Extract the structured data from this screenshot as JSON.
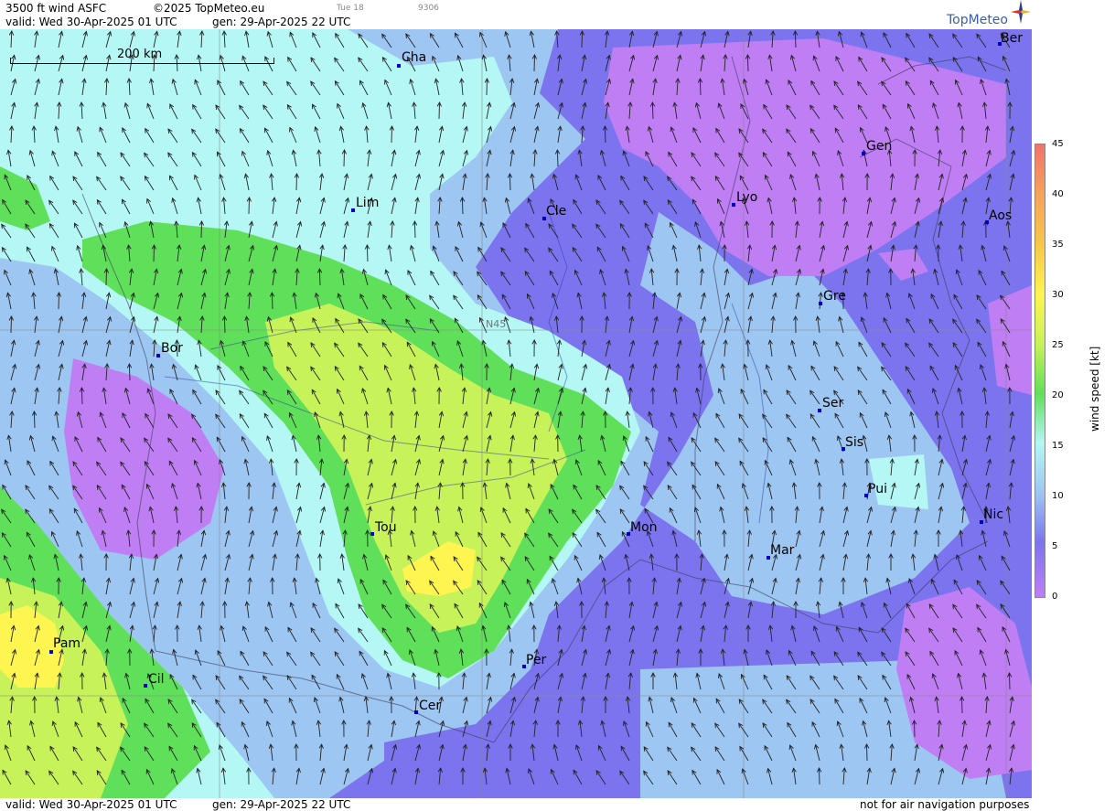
{
  "header": {
    "product": "3500 ft wind ASFC",
    "copyright": "©2025 TopMeteo.eu",
    "small1": "Tue 18",
    "small2": "9306",
    "valid": "valid:  Wed  30-Apr-2025  01 UTC",
    "gen": "gen: 29-Apr-2025 22 UTC"
  },
  "footer": {
    "valid": "valid:  Wed  30-Apr-2025  01 UTC",
    "gen": "gen: 29-Apr-2025 22 UTC",
    "note": "not for air navigation purposes"
  },
  "logo": "TopMeteo",
  "scale_label": "200 km",
  "lat_label": "N45",
  "legend": {
    "unit": "wind  speed  [kt]",
    "ticks": [
      "45",
      "40",
      "35",
      "30",
      "25",
      "20",
      "15",
      "10",
      "5",
      "0"
    ]
  },
  "colors": {
    "calm": "#c07ef5",
    "light": "#7c74ee",
    "moderate": "#9ec6f2",
    "fresh": "#b4f7f5",
    "strong": "#60e05a",
    "stronger": "#c8f25a",
    "gale": "#fff550",
    "city": "#0000cc"
  },
  "cities": [
    {
      "name": "Ber"
    },
    {
      "name": "Cha"
    },
    {
      "name": "Gen"
    },
    {
      "name": "Lim"
    },
    {
      "name": "Cle"
    },
    {
      "name": "Lyo"
    },
    {
      "name": "Aos"
    },
    {
      "name": "Gre"
    },
    {
      "name": "Bor"
    },
    {
      "name": "Ser"
    },
    {
      "name": "Sis"
    },
    {
      "name": "Pui"
    },
    {
      "name": "Tou"
    },
    {
      "name": "Mon"
    },
    {
      "name": "Nic"
    },
    {
      "name": "Mar"
    },
    {
      "name": "Pam"
    },
    {
      "name": "Per"
    },
    {
      "name": "Cil"
    },
    {
      "name": "Cer"
    }
  ]
}
